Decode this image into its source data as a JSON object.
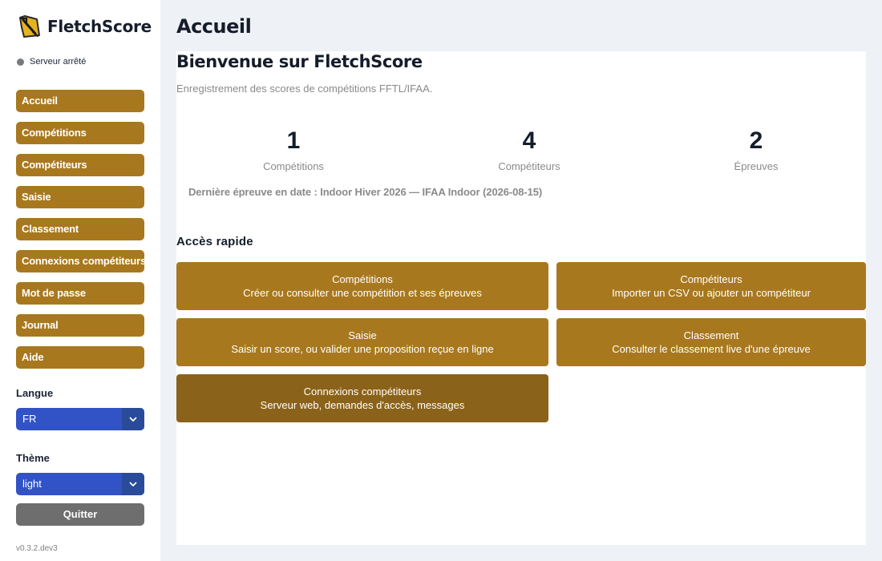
{
  "app": {
    "name": "FletchScore",
    "version": "v0.3.2.dev3"
  },
  "server": {
    "status": "Serveur arrêté",
    "status_color": "#777a80"
  },
  "nav": [
    {
      "label": "Accueil"
    },
    {
      "label": "Compétitions"
    },
    {
      "label": "Compétiteurs"
    },
    {
      "label": "Saisie"
    },
    {
      "label": "Classement"
    },
    {
      "label": "Connexions compétiteurs"
    },
    {
      "label": "Mot de passe"
    },
    {
      "label": "Journal"
    },
    {
      "label": "Aide"
    }
  ],
  "language": {
    "label": "Langue",
    "value": "FR"
  },
  "theme": {
    "label": "Thème",
    "value": "light"
  },
  "quit_label": "Quitter",
  "page": {
    "title": "Accueil",
    "welcome": "Bienvenue sur FletchScore",
    "subtitle": "Enregistrement des scores de compétitions FFTL/IFAA.",
    "stats": [
      {
        "value": "1",
        "label": "Compétitions"
      },
      {
        "value": "4",
        "label": "Compétiteurs"
      },
      {
        "value": "2",
        "label": "Épreuves"
      }
    ],
    "last_event": "Dernière épreuve en date : Indoor Hiver 2026 — IFAA Indoor (2026-08-15)",
    "quick_access_title": "Accès rapide",
    "quick_access": [
      {
        "title": "Compétitions",
        "description": "Créer ou consulter une compétition et ses épreuves"
      },
      {
        "title": "Compétiteurs",
        "description": "Importer un CSV ou ajouter un compétiteur"
      },
      {
        "title": "Saisie",
        "description": "Saisir un score, ou valider une proposition reçue en ligne"
      },
      {
        "title": "Classement",
        "description": "Consulter le classement live d'une épreuve"
      },
      {
        "title": "Connexions compétiteurs",
        "description": "Serveur web, demandes d'accès, messages"
      }
    ]
  },
  "colors": {
    "accent": "#a8781f",
    "accent_dark": "#8b6219",
    "select_bg": "#3153c6",
    "quit_bg": "#6e6e6e",
    "background": "#eef1f6"
  },
  "icons": {
    "logo": "arrow-quiver-logo-icon",
    "select_arrow": "chevron-down-icon",
    "server_status": "status-dot-icon"
  }
}
